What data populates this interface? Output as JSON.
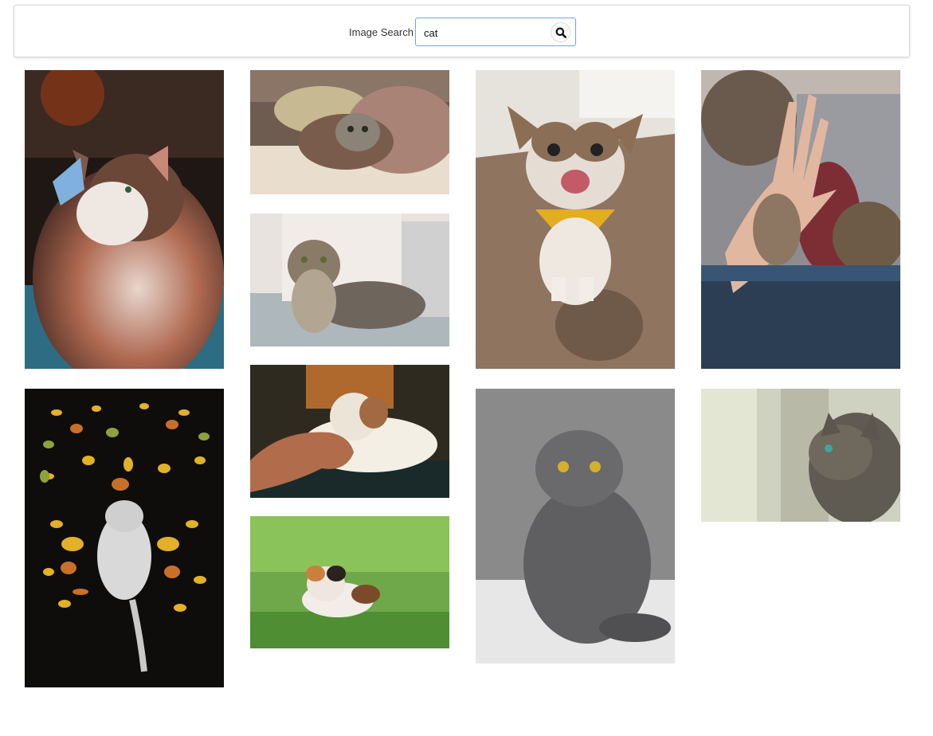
{
  "search": {
    "label": "Image Search",
    "value": "cat",
    "button_icon": "search-icon"
  },
  "results": [
    {
      "subject": "cat-with-butterfly"
    },
    {
      "subject": "cat-under-blanket"
    },
    {
      "subject": "happy-cat-yellow-bandana"
    },
    {
      "subject": "cat-high-five-hand"
    },
    {
      "subject": "tabby-cat-on-sofa"
    },
    {
      "subject": "cat-chin-scratch"
    },
    {
      "subject": "kitten-among-autumn-leaves"
    },
    {
      "subject": "calico-cat-in-grass"
    },
    {
      "subject": "grey-scottish-fold-cat"
    },
    {
      "subject": "tabby-cat-profile-window"
    }
  ],
  "colors": {
    "input_border": "#6fa8d6",
    "panel_border": "#d6d6d6"
  }
}
